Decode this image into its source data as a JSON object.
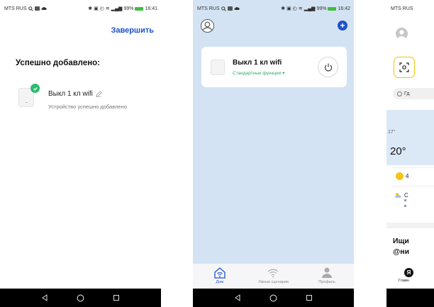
{
  "screen1": {
    "status": {
      "carrier": "MTS RUS",
      "battery": "99%",
      "time": "16:41"
    },
    "finish_label": "Завершить",
    "heading": "Успешно добавлено:",
    "device_name": "Выкл 1 кл wifi",
    "device_status": "Устройство успешно добавлено"
  },
  "screen2": {
    "status": {
      "carrier": "MTS RUS",
      "battery": "99%",
      "time": "16:42"
    },
    "device_name": "Выкл 1 кл wifi",
    "device_functions": "Стандартные функции ▾",
    "tabs": [
      {
        "label": "Дом",
        "icon": "home-wifi-icon"
      },
      {
        "label": "Умные сценарии",
        "icon": "wifi-icon"
      },
      {
        "label": "Профиль",
        "icon": "profile-icon"
      }
    ]
  },
  "screen3": {
    "status": {
      "carrier": "MTS RUS"
    },
    "chip_text": "Гд",
    "weather_small": "17°",
    "weather_big": "20°",
    "row_a": "4",
    "row_b": "С",
    "promo_line1": "Ищи",
    "promo_line2": "@ни",
    "tab_label": "Главн"
  },
  "colors": {
    "accent": "#1d52c9",
    "success": "#2dba6e",
    "home_bg": "#d3e3f4"
  }
}
